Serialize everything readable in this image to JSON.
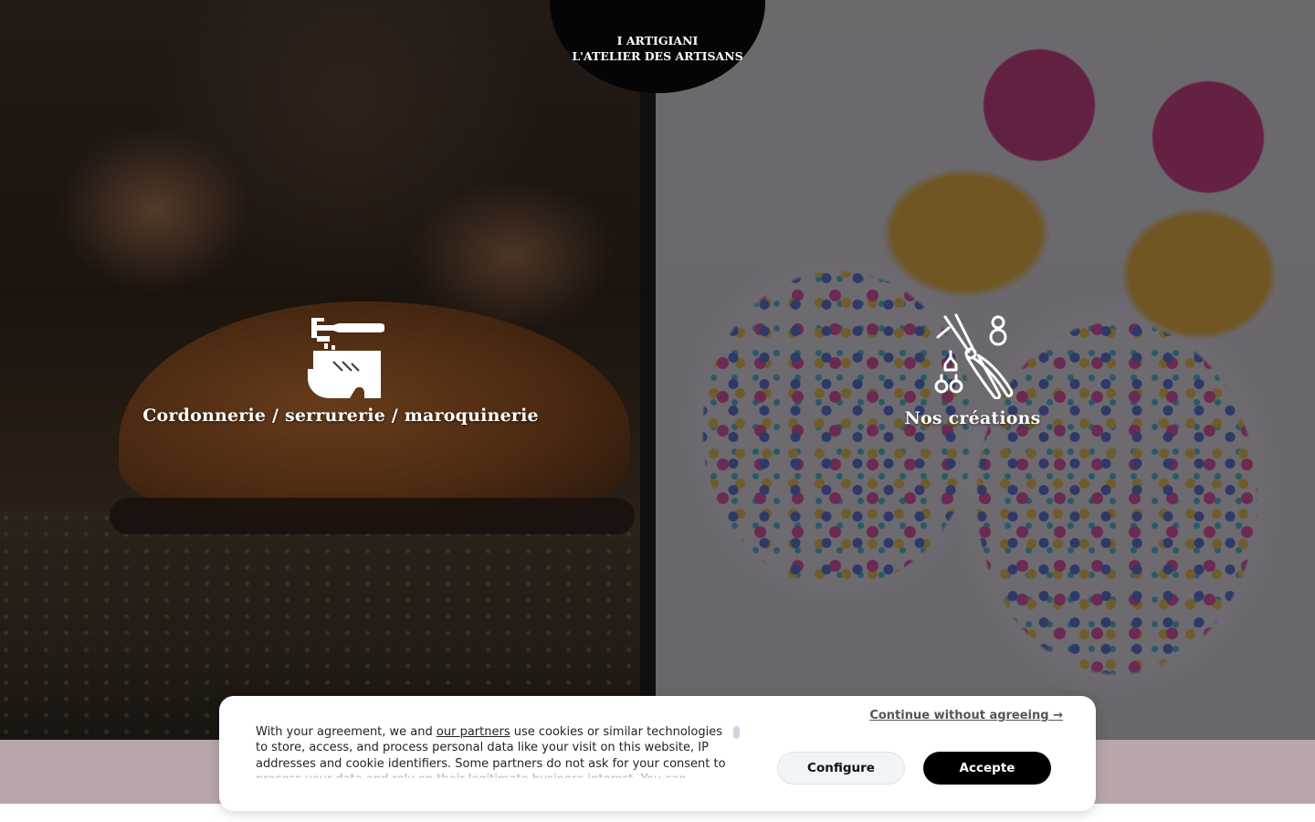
{
  "header": {
    "logo_line1": "I ARTIGIANI",
    "logo_line2": "L'ATELIER DES ARTISANS",
    "logo_bg_color": "#050505"
  },
  "panels": [
    {
      "label": "Cordonnerie / serrurerie / maroquinerie",
      "icon": "cobbler-shoe-icon",
      "image": "artisan-lacing-leather-brogue-shoe"
    },
    {
      "label": "Nos créations",
      "icon": "jewelry-pliers-icon",
      "image": "colorful-confetti-resin-earrings"
    }
  ],
  "cookie_banner": {
    "text_before_link": "With your agreement, we and ",
    "link_text": "our partners",
    "text_after_link": " use cookies or similar technologies to store, access, and process personal data like your visit on this website, IP addresses and cookie identifiers. Some partners do not ask for your consent to process your data and rely on their legitimate business interest. You can",
    "continue_label": "Continue without agreeing →",
    "configure_label": "Configure",
    "accept_label": "Accepte"
  },
  "colors": {
    "band": "#b8a7aa",
    "divider": "#0f0f0f",
    "accept_button": "#000000",
    "configure_button": "#f2f5f8"
  }
}
